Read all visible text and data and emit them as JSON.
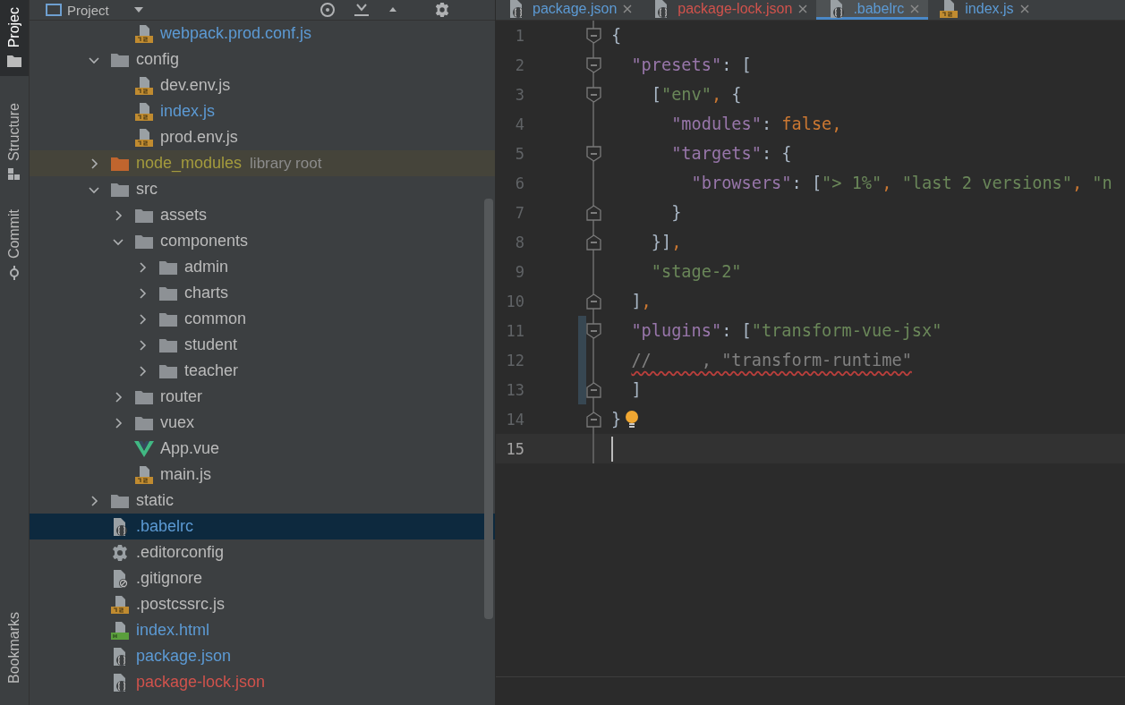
{
  "strip": {
    "items": [
      {
        "label": "Projec",
        "kind": "project",
        "selected": true
      },
      {
        "label": "Structure",
        "kind": "structure",
        "selected": false
      },
      {
        "label": "Commit",
        "kind": "commit",
        "selected": false
      }
    ],
    "bottom_items": [
      {
        "label": "Bookmarks",
        "selected": false
      }
    ]
  },
  "project_panel": {
    "title": "Project"
  },
  "tabs": [
    {
      "label": "package.json",
      "kind": "json",
      "color": "#5c9ad4",
      "selected": false
    },
    {
      "label": "package-lock.json",
      "kind": "json",
      "color": "#d0524c",
      "selected": false
    },
    {
      "label": ".babelrc",
      "kind": "json",
      "color": "#5c9ad4",
      "selected": true
    },
    {
      "label": "index.js",
      "kind": "js",
      "color": "#5c9ad4",
      "selected": false
    }
  ],
  "tree": {
    "items": [
      {
        "children": [
          {
            "name": "webpack.prod.conf.js",
            "kind": "js",
            "color": "#5c9ad4",
            "selected": false
          }
        ]
      },
      {
        "name": "config",
        "kind": "folder",
        "expanded": true,
        "color": "#bbbbbb",
        "selected": false,
        "children": [
          {
            "name": "dev.env.js",
            "kind": "js",
            "color": "#bbbbbb",
            "selected": false
          },
          {
            "name": "index.js",
            "kind": "js",
            "color": "#5c9ad4",
            "selected": false
          },
          {
            "name": "prod.env.js",
            "kind": "js",
            "color": "#bbbbbb",
            "selected": false
          }
        ]
      },
      {
        "name": "node_modules",
        "kind": "folder",
        "expanded": false,
        "excluded": true,
        "color": "#a49b3d",
        "hint": "library root",
        "selected": false
      },
      {
        "name": "src",
        "kind": "folder",
        "expanded": true,
        "color": "#bbbbbb",
        "selected": false,
        "children": [
          {
            "name": "assets",
            "kind": "folder",
            "expanded": false,
            "color": "#bbbbbb",
            "selected": false
          },
          {
            "name": "components",
            "kind": "folder",
            "expanded": true,
            "color": "#bbbbbb",
            "selected": false,
            "children": [
              {
                "name": "admin",
                "kind": "folder",
                "expanded": false,
                "color": "#bbbbbb",
                "selected": false
              },
              {
                "name": "charts",
                "kind": "folder",
                "expanded": false,
                "color": "#bbbbbb",
                "selected": false
              },
              {
                "name": "common",
                "kind": "folder",
                "expanded": false,
                "color": "#bbbbbb",
                "selected": false
              },
              {
                "name": "student",
                "kind": "folder",
                "expanded": false,
                "color": "#bbbbbb",
                "selected": false
              },
              {
                "name": "teacher",
                "kind": "folder",
                "expanded": false,
                "color": "#bbbbbb",
                "selected": false
              }
            ]
          },
          {
            "name": "router",
            "kind": "folder",
            "expanded": false,
            "color": "#bbbbbb",
            "selected": false
          },
          {
            "name": "vuex",
            "kind": "folder",
            "expanded": false,
            "color": "#bbbbbb",
            "selected": false
          },
          {
            "name": "App.vue",
            "kind": "vue",
            "color": "#bbbbbb",
            "selected": false
          },
          {
            "name": "main.js",
            "kind": "js",
            "color": "#bbbbbb",
            "selected": false
          }
        ]
      },
      {
        "name": "static",
        "kind": "folder",
        "expanded": false,
        "color": "#bbbbbb",
        "selected": false
      },
      {
        "name": ".babelrc",
        "kind": "json",
        "color": "#5c9ad4",
        "selected": true
      },
      {
        "name": ".editorconfig",
        "kind": "config",
        "color": "#bbbbbb",
        "selected": false
      },
      {
        "name": ".gitignore",
        "kind": "ignore",
        "color": "#bbbbbb",
        "selected": false
      },
      {
        "name": ".postcssrc.js",
        "kind": "js",
        "color": "#bbbbbb",
        "selected": false
      },
      {
        "name": "index.html",
        "kind": "html",
        "color": "#5c9ad4",
        "selected": false
      },
      {
        "name": "package.json",
        "kind": "json",
        "color": "#5c9ad4",
        "selected": false
      },
      {
        "name": "package-lock.json",
        "kind": "json",
        "color": "#d0524c",
        "selected": false
      }
    ]
  },
  "editor": {
    "lines": [
      {
        "number": "1",
        "fold_open": true,
        "changed": false,
        "current": false,
        "bulb": false,
        "tokens": [
          {
            "color": "#a9b7c6",
            "text": "{"
          }
        ]
      },
      {
        "number": "2",
        "fold_open": true,
        "changed": false,
        "current": false,
        "bulb": false,
        "tokens": [
          {
            "color": "#9876aa",
            "text": "  \"presets\""
          },
          {
            "color": "#a9b7c6",
            "text": ": ["
          }
        ]
      },
      {
        "number": "3",
        "fold_open": true,
        "changed": false,
        "current": false,
        "bulb": false,
        "tokens": [
          {
            "color": "#a9b7c6",
            "text": "    ["
          },
          {
            "color": "#6a8759",
            "text": "\"env\""
          },
          {
            "color": "#cc7832",
            "text": ","
          },
          {
            "color": "#a9b7c6",
            "text": " {"
          }
        ]
      },
      {
        "number": "4",
        "changed": false,
        "current": false,
        "bulb": false,
        "tokens": [
          {
            "color": "#9876aa",
            "text": "      \"modules\""
          },
          {
            "color": "#a9b7c6",
            "text": ": "
          },
          {
            "color": "#cc7832",
            "text": "false,"
          }
        ]
      },
      {
        "number": "5",
        "fold_open": true,
        "changed": false,
        "current": false,
        "bulb": false,
        "tokens": [
          {
            "color": "#9876aa",
            "text": "      \"targets\""
          },
          {
            "color": "#a9b7c6",
            "text": ": {"
          }
        ]
      },
      {
        "number": "6",
        "changed": false,
        "current": false,
        "bulb": false,
        "tokens": [
          {
            "color": "#9876aa",
            "text": "        \"browsers\""
          },
          {
            "color": "#a9b7c6",
            "text": ": ["
          },
          {
            "color": "#6a8759",
            "text": "\"> 1%\""
          },
          {
            "color": "#cc7832",
            "text": ","
          },
          {
            "color": "#6a8759",
            "text": " \"last 2 versions\""
          },
          {
            "color": "#cc7832",
            "text": ","
          },
          {
            "color": "#6a8759",
            "text": " \"n"
          }
        ]
      },
      {
        "number": "7",
        "fold_open": false,
        "changed": false,
        "current": false,
        "bulb": false,
        "tokens": [
          {
            "color": "#a9b7c6",
            "text": "      }"
          }
        ]
      },
      {
        "number": "8",
        "fold_open": false,
        "changed": false,
        "current": false,
        "bulb": false,
        "tokens": [
          {
            "color": "#a9b7c6",
            "text": "    }]"
          },
          {
            "color": "#cc7832",
            "text": ","
          }
        ]
      },
      {
        "number": "9",
        "changed": false,
        "current": false,
        "bulb": false,
        "tokens": [
          {
            "color": "#6a8759",
            "text": "    \"stage-2\""
          }
        ]
      },
      {
        "number": "10",
        "fold_open": false,
        "changed": false,
        "current": false,
        "bulb": false,
        "tokens": [
          {
            "color": "#a9b7c6",
            "text": "  ]"
          },
          {
            "color": "#cc7832",
            "text": ","
          }
        ]
      },
      {
        "number": "11",
        "fold_open": true,
        "changed": true,
        "current": false,
        "bulb": false,
        "tokens": [
          {
            "color": "#9876aa",
            "text": "  \"plugins\""
          },
          {
            "color": "#a9b7c6",
            "text": ": ["
          },
          {
            "color": "#6a8759",
            "text": "\"transform-vue-jsx\""
          }
        ]
      },
      {
        "number": "12",
        "changed": true,
        "current": false,
        "bulb": false,
        "tokens": [
          {
            "color": "#808080",
            "error": true,
            "text": "  //     , \"transform-runtime\""
          }
        ]
      },
      {
        "number": "13",
        "fold_open": false,
        "changed": true,
        "current": false,
        "bulb": false,
        "tokens": [
          {
            "color": "#a9b7c6",
            "text": "  ]"
          }
        ]
      },
      {
        "number": "14",
        "fold_open": false,
        "changed": false,
        "current": false,
        "bulb": true,
        "tokens": [
          {
            "color": "#a9b7c6",
            "text": "}"
          }
        ]
      },
      {
        "number": "15",
        "changed": false,
        "current": true,
        "bulb": false
      }
    ]
  }
}
